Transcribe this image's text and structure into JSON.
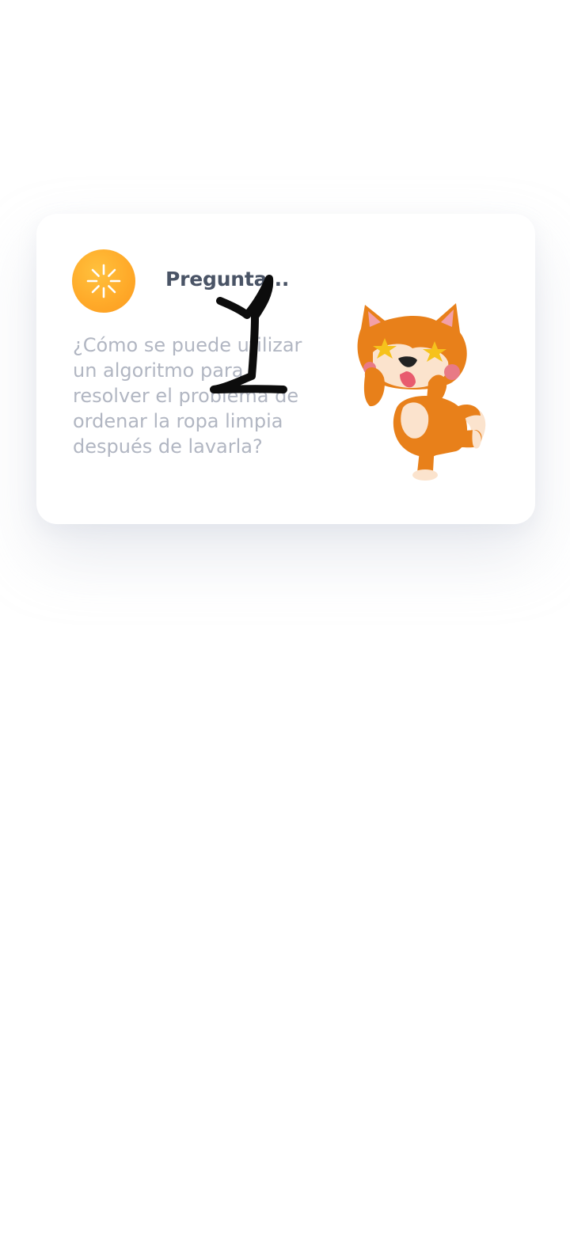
{
  "card": {
    "title": "Pregunta...",
    "question": "¿Cómo se puede utilizar un algoritmo para resolver el problema de ordenar la ropa limpia después de lavarla?"
  },
  "icons": {
    "status": "loading-spinner-icon",
    "mascot": "dancing-shiba-dog-illustration",
    "overlay": "handwritten-number-one-scribble"
  },
  "colors": {
    "badge": "#ffab2a",
    "title": "#4a5466",
    "question": "#b1b6c2",
    "mascot_orange": "#e8801a"
  }
}
